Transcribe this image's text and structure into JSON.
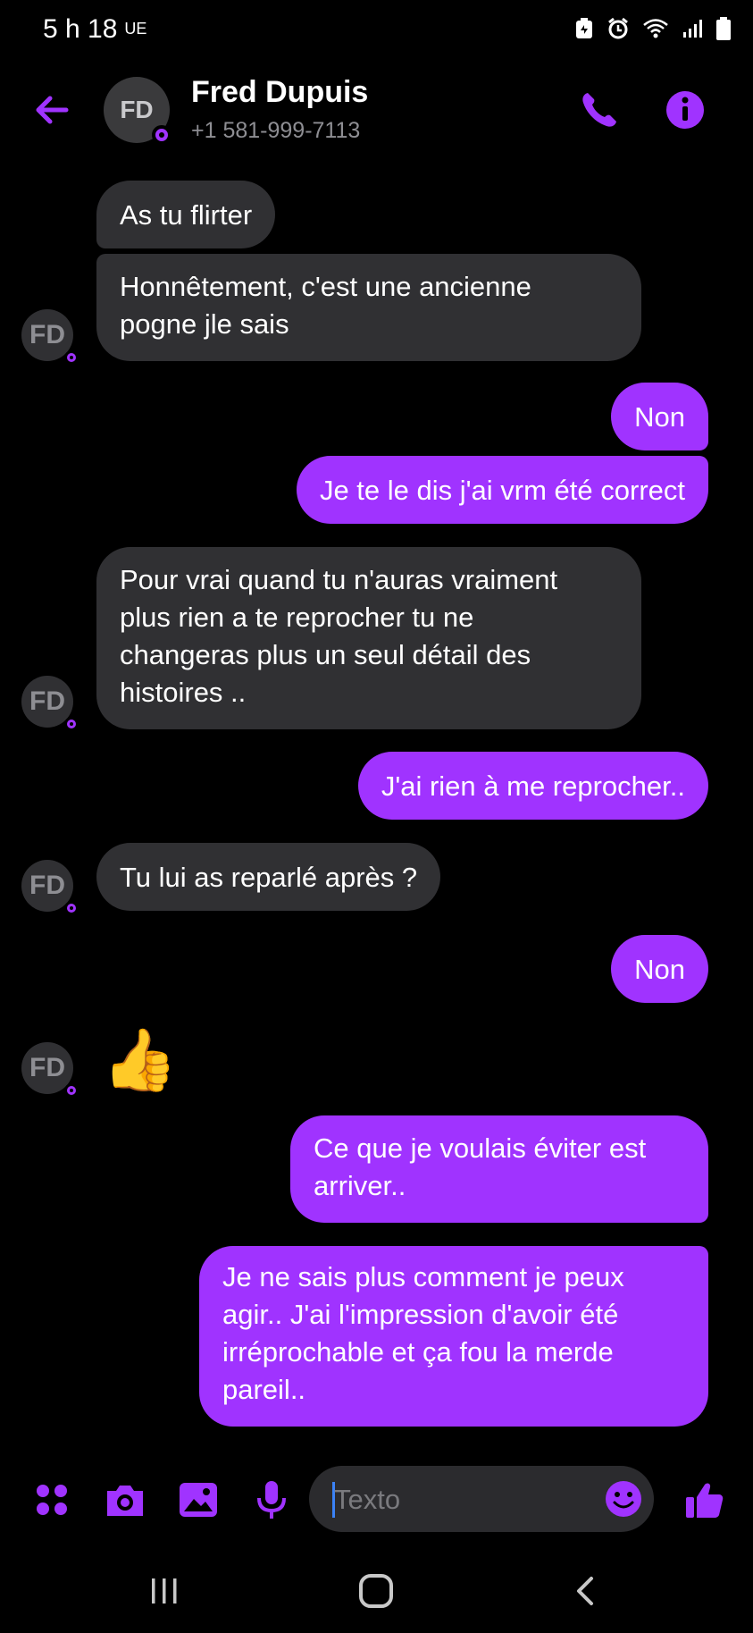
{
  "status_bar": {
    "time": "5 h 18",
    "carrier_tag": "UE"
  },
  "header": {
    "contact_name": "Fred Dupuis",
    "contact_phone": "+1 581-999-7113",
    "avatar_initials": "FD"
  },
  "messages": [
    {
      "from": "them",
      "text": "As tu flirter"
    },
    {
      "from": "them",
      "text": "Honnêtement, c'est une ancienne\npogne jle sais"
    },
    {
      "from": "me",
      "text": "Non"
    },
    {
      "from": "me",
      "text": "Je te le dis j'ai vrm été correct"
    },
    {
      "from": "them",
      "text": "Pour vrai quand tu n'auras vraiment\nplus rien a te reprocher tu ne\nchangeras plus un seul détail des\nhistoires .."
    },
    {
      "from": "me",
      "text": "J'ai rien à me reprocher.."
    },
    {
      "from": "them",
      "text": "Tu lui as reparlé après ?"
    },
    {
      "from": "me",
      "text": "Non"
    },
    {
      "from": "them",
      "text": "👍"
    },
    {
      "from": "me",
      "text": "Ce que je voulais éviter est\narriver.."
    },
    {
      "from": "me",
      "text": "Je ne sais plus comment je peux\nagir.. J'ai l'impression d'avoir été\nirréprochable et ça fou la merde\npareil.."
    }
  ],
  "composer": {
    "placeholder": "Texto"
  },
  "colors": {
    "accent": "#a033ff",
    "incoming_bubble": "#303033",
    "background": "#000000"
  },
  "icons": {
    "header": [
      "back-arrow-icon",
      "phone-icon",
      "info-icon"
    ],
    "composer": [
      "apps-icon",
      "camera-icon",
      "gallery-icon",
      "microphone-icon",
      "emoji-icon",
      "thumbs-up-icon"
    ],
    "navigation": [
      "recent-apps-icon",
      "home-icon",
      "back-icon"
    ]
  }
}
